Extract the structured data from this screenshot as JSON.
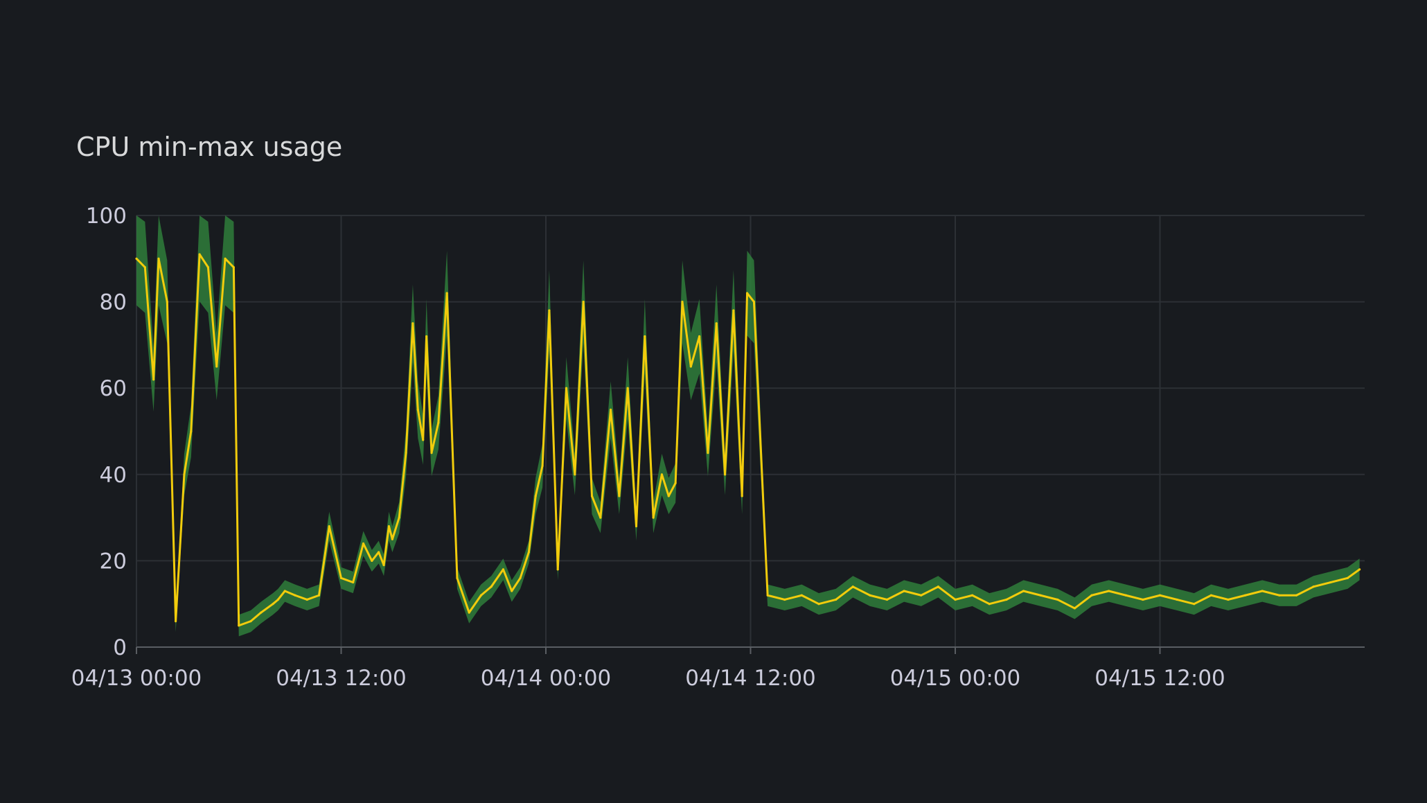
{
  "panel": {
    "title": "CPU min-max usage"
  },
  "chart_data": {
    "type": "area",
    "title": "CPU min-max usage",
    "xlabel": "",
    "ylabel": "",
    "ylim": [
      0,
      100
    ],
    "yticks": [
      0,
      20,
      40,
      60,
      80,
      100
    ],
    "xlim": [
      "04/13 00:00",
      "04/15 23:59"
    ],
    "xticks": [
      "04/13 00:00",
      "04/13 12:00",
      "04/14 00:00",
      "04/14 12:00",
      "04/15 00:00",
      "04/15 12:00"
    ],
    "grid": true,
    "legend": "none",
    "colors": {
      "background": "#181b1f",
      "grid": "#2c3035",
      "band": "#2f7d3b",
      "line": "#f2cc0c",
      "text": "#ccccdc"
    },
    "x_hours": [
      0,
      0.5,
      1,
      1.3,
      1.8,
      2.3,
      2.8,
      3.2,
      3.7,
      4.2,
      4.7,
      5.2,
      5.7,
      6,
      6.7,
      7.3,
      8,
      8.3,
      8.7,
      9.3,
      10,
      10.7,
      11.3,
      12,
      12.7,
      13.3,
      13.8,
      14.2,
      14.5,
      14.8,
      15,
      15.4,
      15.8,
      16.2,
      16.5,
      16.8,
      17,
      17.3,
      17.7,
      18.2,
      18.8,
      19.5,
      20.2,
      20.8,
      21.5,
      22,
      22.5,
      23,
      23.4,
      23.8,
      24.2,
      24.7,
      25.2,
      25.7,
      26.2,
      26.7,
      27.2,
      27.8,
      28.3,
      28.8,
      29.3,
      29.8,
      30.3,
      30.8,
      31.2,
      31.6,
      32,
      32.5,
      33,
      33.5,
      34,
      34.5,
      35,
      35.5,
      35.8,
      36.2,
      37,
      38,
      39,
      40,
      41,
      42,
      43,
      44,
      45,
      46,
      47,
      48,
      49,
      50,
      51,
      52,
      53,
      54,
      55,
      56,
      57,
      58,
      59,
      60,
      61,
      62,
      63,
      64,
      65,
      66,
      67,
      68,
      69,
      70,
      71,
      71.7
    ],
    "series": [
      {
        "values": [
          90,
          88,
          62,
          90,
          80,
          6,
          40,
          50,
          91,
          88,
          65,
          90,
          88,
          5,
          6,
          8,
          10,
          11,
          13,
          12,
          11,
          12,
          28,
          16,
          15,
          24,
          20,
          22,
          19,
          28,
          25,
          30,
          45,
          75,
          55,
          48,
          72,
          45,
          52,
          82,
          16,
          8,
          12,
          14,
          18,
          13,
          16,
          22,
          35,
          42,
          78,
          18,
          60,
          40,
          80,
          35,
          30,
          55,
          35,
          60,
          28,
          72,
          30,
          40,
          35,
          38,
          80,
          65,
          72,
          45,
          75,
          40,
          78,
          35,
          82,
          80,
          12,
          11,
          12,
          10,
          11,
          14,
          12,
          11,
          13,
          12,
          14,
          11,
          12,
          10,
          11,
          13,
          12,
          11,
          9,
          12,
          13,
          12,
          11,
          12,
          11,
          10,
          12,
          11,
          12,
          13,
          12,
          12,
          14,
          15,
          16,
          18
        ]
      }
    ]
  }
}
